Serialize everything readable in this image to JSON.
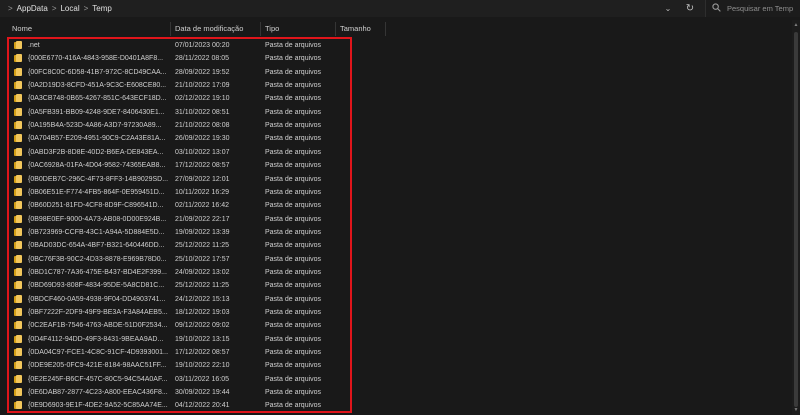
{
  "address": {
    "crumbs": [
      "AppData",
      "Local",
      "Temp"
    ],
    "separator": ">",
    "dropdown_glyph": "⌄",
    "refresh_glyph": "↻"
  },
  "search": {
    "placeholder": "Pesquisar em Temp"
  },
  "columns": {
    "name": "Nome",
    "date": "Data de modificação",
    "type": "Tipo",
    "size": "Tamanho"
  },
  "rows": [
    {
      "name": ".net",
      "date": "07/01/2023 00:20",
      "type": "Pasta de arquivos"
    },
    {
      "name": "{000E6770-416A-4843-958E-D0401A8F8...",
      "date": "28/11/2022 08:05",
      "type": "Pasta de arquivos"
    },
    {
      "name": "{00FC8C0C-6D58-41B7-972C-8CD49CAA...",
      "date": "28/09/2022 19:52",
      "type": "Pasta de arquivos"
    },
    {
      "name": "{0A2D19D3-8CFD-451A-9C3C-E608CE80...",
      "date": "21/10/2022 17:09",
      "type": "Pasta de arquivos"
    },
    {
      "name": "{0A3CB748-0B65-4267-851C-643ECF18D...",
      "date": "02/12/2022 19:10",
      "type": "Pasta de arquivos"
    },
    {
      "name": "{0A5FB391-BB09-4248-9DE7-8406430E1...",
      "date": "31/10/2022 08:51",
      "type": "Pasta de arquivos"
    },
    {
      "name": "{0A195B4A-523D-4A86-A3D7-97230A89...",
      "date": "21/10/2022 08:08",
      "type": "Pasta de arquivos"
    },
    {
      "name": "{0A704B57-E209-4951-90C9-C2A43E81A...",
      "date": "26/09/2022 19:30",
      "type": "Pasta de arquivos"
    },
    {
      "name": "{0ABD3F2B-8D8E-40D2-B6EA-DE843EA...",
      "date": "03/10/2022 13:07",
      "type": "Pasta de arquivos"
    },
    {
      "name": "{0AC6928A-01FA-4D04-9582-74365EAB8...",
      "date": "17/12/2022 08:57",
      "type": "Pasta de arquivos"
    },
    {
      "name": "{0B0DEB7C-296C-4F73-8FF3-14B9029SD...",
      "date": "27/09/2022 12:01",
      "type": "Pasta de arquivos"
    },
    {
      "name": "{0B06E51E-F774-4FB5-864F-0E959451D...",
      "date": "10/11/2022 16:29",
      "type": "Pasta de arquivos"
    },
    {
      "name": "{0B60D251-81FD-4CF8-8D9F-C896541D...",
      "date": "02/11/2022 16:42",
      "type": "Pasta de arquivos"
    },
    {
      "name": "{0B98E0EF-9000-4A73-AB08-0D00E924B...",
      "date": "21/09/2022 22:17",
      "type": "Pasta de arquivos"
    },
    {
      "name": "{0B723969-CCFB-43C1-A94A-5D884E5D...",
      "date": "19/09/2022 13:39",
      "type": "Pasta de arquivos"
    },
    {
      "name": "{0BAD03DC-654A-4BF7-B321-640446DD...",
      "date": "25/12/2022 11:25",
      "type": "Pasta de arquivos"
    },
    {
      "name": "{0BC76F3B-90C2-4D33-8878-E969B78D0...",
      "date": "25/10/2022 17:57",
      "type": "Pasta de arquivos"
    },
    {
      "name": "{0BD1C787-7A36-475E-B437-BD4E2F399...",
      "date": "24/09/2022 13:02",
      "type": "Pasta de arquivos"
    },
    {
      "name": "{0BD69D93-808F-4834-95DE-5A8CD81C...",
      "date": "25/12/2022 11:25",
      "type": "Pasta de arquivos"
    },
    {
      "name": "{0BDCF460-0A59-4938-9F04-DD4903741...",
      "date": "24/12/2022 15:13",
      "type": "Pasta de arquivos"
    },
    {
      "name": "{0BF7222F-2DF9-49F9-BE3A-F3A84AEB5...",
      "date": "18/12/2022 19:03",
      "type": "Pasta de arquivos"
    },
    {
      "name": "{0C2EAF1B-7546-4763-ABDE-51D0F2534...",
      "date": "09/12/2022 09:02",
      "type": "Pasta de arquivos"
    },
    {
      "name": "{0D4F4112-94DD-49F3-8431-9BEAA9AD...",
      "date": "19/10/2022 13:15",
      "type": "Pasta de arquivos"
    },
    {
      "name": "{0DA04C97-FCE1-4C8C-91CF-4D9393001...",
      "date": "17/12/2022 08:57",
      "type": "Pasta de arquivos"
    },
    {
      "name": "{0DE9E205-0FC9-421E-8184-98AAC51FF...",
      "date": "19/10/2022 22:10",
      "type": "Pasta de arquivos"
    },
    {
      "name": "{0E2E245F-B6CF-457C-80C5-94C54A0AF...",
      "date": "03/11/2022 16:05",
      "type": "Pasta de arquivos"
    },
    {
      "name": "{0E6DAB87-2877-4C23-A800-EEAC436F8...",
      "date": "30/09/2022 19:44",
      "type": "Pasta de arquivos"
    },
    {
      "name": "{0E9D6903-9E1F-4DE2-9A52-5C85AA74E...",
      "date": "04/12/2022 20:41",
      "type": "Pasta de arquivos"
    }
  ],
  "colors": {
    "background": "#191919",
    "text": "#d0d0d0",
    "highlight_border": "#e0151b",
    "folder_front": "#f2c75c",
    "folder_back": "#d4a017"
  }
}
